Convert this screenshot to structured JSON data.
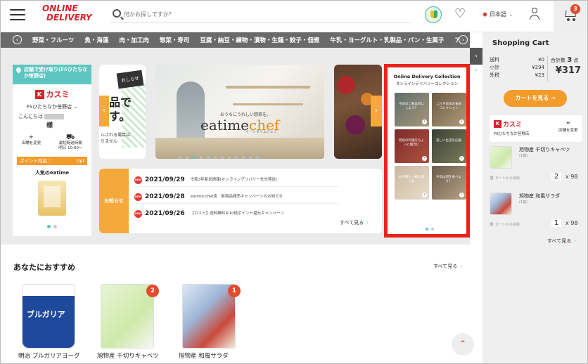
{
  "header": {
    "logo_line1": "ONLINE",
    "logo_line2": "DELIVERY",
    "search_placeholder": "何かお探しですか？",
    "language": "日本語",
    "cart_count": "3"
  },
  "category_nav": {
    "items": [
      "野菜・フルーツ",
      "魚・海藻",
      "肉・加工肉",
      "惣菜・寿司",
      "豆腐・納豆・練物・漬物・生麺・餃子・佃煮",
      "牛乳・ヨーグルト・乳製品・パン・生菓子",
      "ア"
    ]
  },
  "store_card": {
    "header": "店舗で受け取り(FSひたちなか笹野店)",
    "chain": "カスミ",
    "store": "FSひたちなか笹野店",
    "greeting": "こんにちは",
    "honorific": "様",
    "action_change": "店舗を変更",
    "action_delivery_line1": "最短配送時間",
    "action_delivery_line2": "明日 10:00〜",
    "points_label": "ポイント残高：",
    "points_value": "0pt",
    "popular": "人気のeatime"
  },
  "banners": {
    "left_tag": "おしらせ",
    "left_text_line1": "品で",
    "left_text_line2": "す。",
    "left_small_line1": "ルされる場合は",
    "left_small_line2": "りません",
    "center_sub": "おうちにうれしい惣菜を。",
    "center_brand_a": "eatime",
    "center_brand_b": "chef",
    "center_mini": "イートタイムシェフ"
  },
  "news": {
    "label": "お知らせ",
    "new_tag": "NEW",
    "items": [
      {
        "date": "2021/09/29",
        "text": "令和3年新米情報(オンラインデリバリー先先発送)"
      },
      {
        "date": "2021/09/28",
        "text": "eatime chef店　新商品発売キャンペーンのお知らせ"
      },
      {
        "date": "2021/09/26",
        "text": "【カスミ】送料無料＆10倍ポイント還元キャンペーン"
      }
    ],
    "more": "すべて見る"
  },
  "collection": {
    "title_en": "Online Delivery Collection",
    "title_jp": "オンラインデリバリーコレクション",
    "tiles": [
      "今日のご飯は何にしよう？",
      "これぞ日本の食卓コレクション",
      "普段の料理をちょっと贅沢に",
      "美しい生活を応援",
      "お子様と一緒に楽しむ",
      "今日は何を食べよう？"
    ]
  },
  "recommend": {
    "title": "あなたにおすすめ",
    "more": "すべて見る",
    "products": [
      {
        "name": "明治 ブルガリアヨーグ",
        "badge": ""
      },
      {
        "name": "旭物産 千切りキャベツ",
        "badge": "2"
      },
      {
        "name": "旭物産 和風サラダ",
        "badge": "1"
      }
    ]
  },
  "cart": {
    "title": "Shopping Cart",
    "shipping_label": "送料",
    "shipping_value": "¥0",
    "subtotal_label": "小計",
    "subtotal_value": "¥294",
    "tax_label": "外税",
    "tax_value": "¥23",
    "count_label": "合計数",
    "count_value": "3",
    "count_unit": "点",
    "total": "¥317",
    "view_button": "カートを見る →",
    "chain": "カスミ",
    "store": "FSひたちなか笹野店",
    "change_store": "店舗を変更",
    "items": [
      {
        "name": "旭物産 千切りキャベツ",
        "sub": "(1袋)",
        "delete": "カートから削除",
        "qty": "2",
        "price": "x 98"
      },
      {
        "name": "旭物産 和風サラダ",
        "sub": "(1袋)",
        "delete": "カートから削除",
        "qty": "1",
        "price": "x 98"
      }
    ],
    "more": "すべて見る"
  }
}
